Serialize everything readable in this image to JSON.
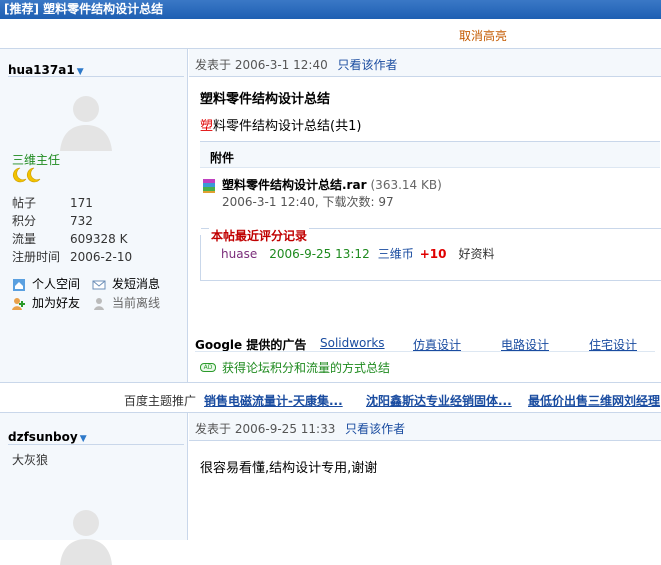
{
  "thread": {
    "tag": "[推荐]",
    "title": "塑料零件结构设计总结"
  },
  "subbar": {
    "cancel_highlight": "取消高亮"
  },
  "post1": {
    "username": "hua137a1",
    "rank": "三维主任",
    "stats": [
      {
        "label": "帖子",
        "value": "171"
      },
      {
        "label": "积分",
        "value": "732"
      },
      {
        "label": "流量",
        "value": "609328 K"
      },
      {
        "label": "注册时间",
        "value": "2006-2-10"
      }
    ],
    "actions": {
      "space": "个人空间",
      "message": "发短消息",
      "friend": "加为好友",
      "status": "当前离线"
    },
    "meta": {
      "posted_label": "发表于",
      "time": "2006-3-1 12:40",
      "only_author": "只看该作者"
    },
    "title": "塑料零件结构设计总结",
    "body_first_char": "塑",
    "body_rest": "料零件结构设计总结(共1)",
    "attachment": {
      "header": "附件",
      "filename": "塑料零件结构设计总结.rar",
      "size": "(363.14 KB)",
      "meta": "2006-3-1 12:40, 下载次数: 97"
    },
    "rating": {
      "title": "本帖最近评分记录",
      "user": "huase",
      "time": "2006-9-25 13:12",
      "currency": "三维币",
      "points": "+10",
      "reason": "好资料"
    },
    "ads": {
      "label": "Google 提供的广告",
      "links": [
        "Solidworks",
        "仿真设计",
        "电路设计",
        "住宅设计"
      ]
    },
    "tip": "获得论坛积分和流量的方式总结"
  },
  "promo": {
    "label": "百度主题推广",
    "links": [
      "销售电磁流量计-天康集...",
      "沈阳鑫斯达专业经销固体...",
      "最低价出售三维网刘经理"
    ]
  },
  "post2": {
    "username": "dzfsunboy",
    "rank": "大灰狼",
    "meta": {
      "posted_label": "发表于",
      "time": "2006-9-25 11:33",
      "only_author": "只看该作者"
    },
    "body": "很容易看懂,结构设计专用,谢谢"
  },
  "colors": {
    "titlebar": "#2a6cc0",
    "link": "#1a4ca0",
    "rank_green": "#1e8a1e",
    "red": "#e00000",
    "border": "#c9d7ea"
  }
}
